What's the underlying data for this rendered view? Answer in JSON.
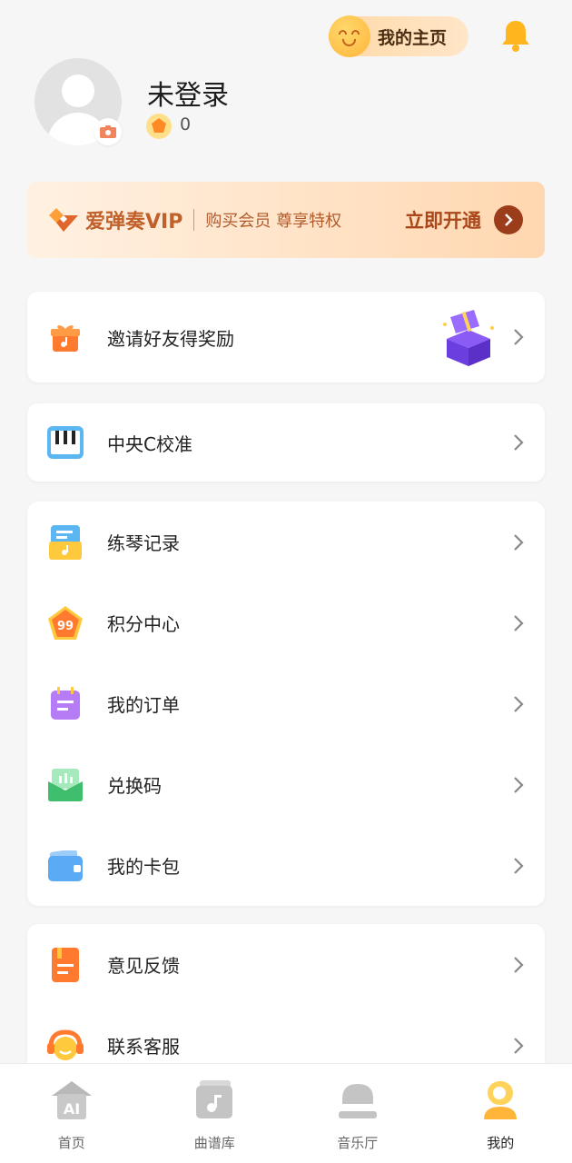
{
  "header": {
    "home_label": "我的主页"
  },
  "profile": {
    "username": "未登录",
    "coin_count": "0"
  },
  "vip": {
    "brand": "爱弹奏VIP",
    "slogan": "购买会员 尊享特权",
    "cta": "立即开通"
  },
  "menu": {
    "invite": {
      "label": "邀请好友得奖励",
      "icon": "gift-icon"
    },
    "calibrate": {
      "label": "中央C校准",
      "icon": "piano-icon"
    },
    "group1": [
      {
        "label": "练琴记录",
        "icon": "practice-record-icon",
        "color": "#ffc93e"
      },
      {
        "label": "积分中心",
        "icon": "points-icon",
        "color": "#ff8a3d"
      },
      {
        "label": "我的订单",
        "icon": "order-icon",
        "color": "#b67cf5"
      },
      {
        "label": "兑换码",
        "icon": "redeem-code-icon",
        "color": "#4fce84"
      },
      {
        "label": "我的卡包",
        "icon": "wallet-icon",
        "color": "#5aaaf5"
      }
    ],
    "group2": [
      {
        "label": "意见反馈",
        "icon": "feedback-icon",
        "color": "#ff8a3d"
      },
      {
        "label": "联系客服",
        "icon": "customer-service-icon",
        "color": "#ffb53a"
      }
    ]
  },
  "tabs": [
    {
      "label": "首页",
      "icon": "ai-home-icon",
      "active": false
    },
    {
      "label": "曲谱库",
      "icon": "sheet-library-icon",
      "active": false
    },
    {
      "label": "音乐厅",
      "icon": "piano-hall-icon",
      "active": false
    },
    {
      "label": "我的",
      "icon": "profile-icon",
      "active": true
    }
  ],
  "colors": {
    "accent": "#ffb53a",
    "vip_text": "#c0602b",
    "vip_button": "#9b3d1b"
  }
}
